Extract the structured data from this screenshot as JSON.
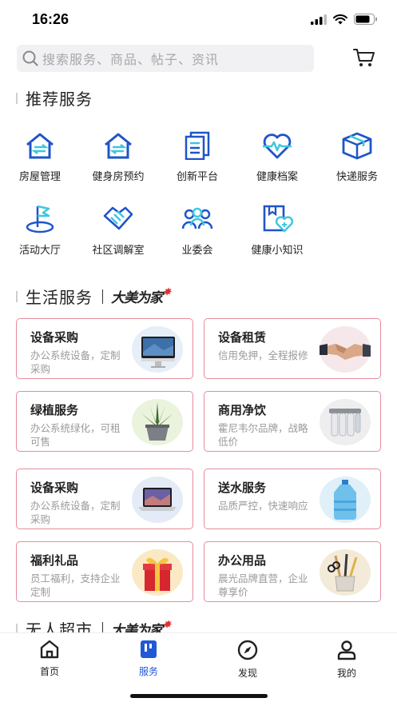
{
  "status": {
    "time": "16:26"
  },
  "search": {
    "placeholder": "搜索服务、商品、帖子、资讯"
  },
  "recommend": {
    "title": "推荐服务",
    "items": [
      {
        "label": "房屋管理",
        "icon": "house-icon"
      },
      {
        "label": "健身房预约",
        "icon": "gym-house-icon"
      },
      {
        "label": "创新平台",
        "icon": "documents-icon"
      },
      {
        "label": "健康档案",
        "icon": "heart-pulse-icon"
      },
      {
        "label": "快递服务",
        "icon": "package-icon"
      },
      {
        "label": "活动大厅",
        "icon": "flag-icon"
      },
      {
        "label": "社区调解室",
        "icon": "handshake-icon"
      },
      {
        "label": "业委会",
        "icon": "people-icon"
      },
      {
        "label": "健康小知识",
        "icon": "health-book-icon"
      }
    ]
  },
  "life": {
    "title": "生活服务",
    "brand": "大美为家",
    "cards": [
      {
        "title": "设备采购",
        "desc": "办公系统设备，定制采购",
        "image": "desktop-computer-image"
      },
      {
        "title": "设备租赁",
        "desc": "信用免押，全程报修",
        "image": "handshake-image"
      },
      {
        "title": "绿植服务",
        "desc": "办公系统绿化，可租可售",
        "image": "potted-plant-image"
      },
      {
        "title": "商用净饮",
        "desc": "霍尼韦尔品牌，战略低价",
        "image": "water-purifier-image"
      },
      {
        "title": "设备采购",
        "desc": "办公系统设备，定制采购",
        "image": "laptop-image"
      },
      {
        "title": "送水服务",
        "desc": "品质严控，快速响应",
        "image": "water-bottle-image"
      },
      {
        "title": "福利礼品",
        "desc": "员工福利，支持企业定制",
        "image": "gift-box-image"
      },
      {
        "title": "办公用品",
        "desc": "晨光品牌直营，企业尊享价",
        "image": "pen-holder-image"
      }
    ]
  },
  "market": {
    "title": "无人超市",
    "brand": "大美为家"
  },
  "nav": {
    "items": [
      {
        "label": "首页",
        "icon": "home-icon"
      },
      {
        "label": "服务",
        "icon": "service-icon"
      },
      {
        "label": "发现",
        "icon": "compass-icon"
      },
      {
        "label": "我的",
        "icon": "user-icon"
      }
    ],
    "active_color": "#2158d6"
  },
  "colors": {
    "accent": "#2158d6",
    "card_border": "#e48d9d",
    "icon_blue": "#1f55c8",
    "icon_cyan": "#3ec7e0"
  }
}
